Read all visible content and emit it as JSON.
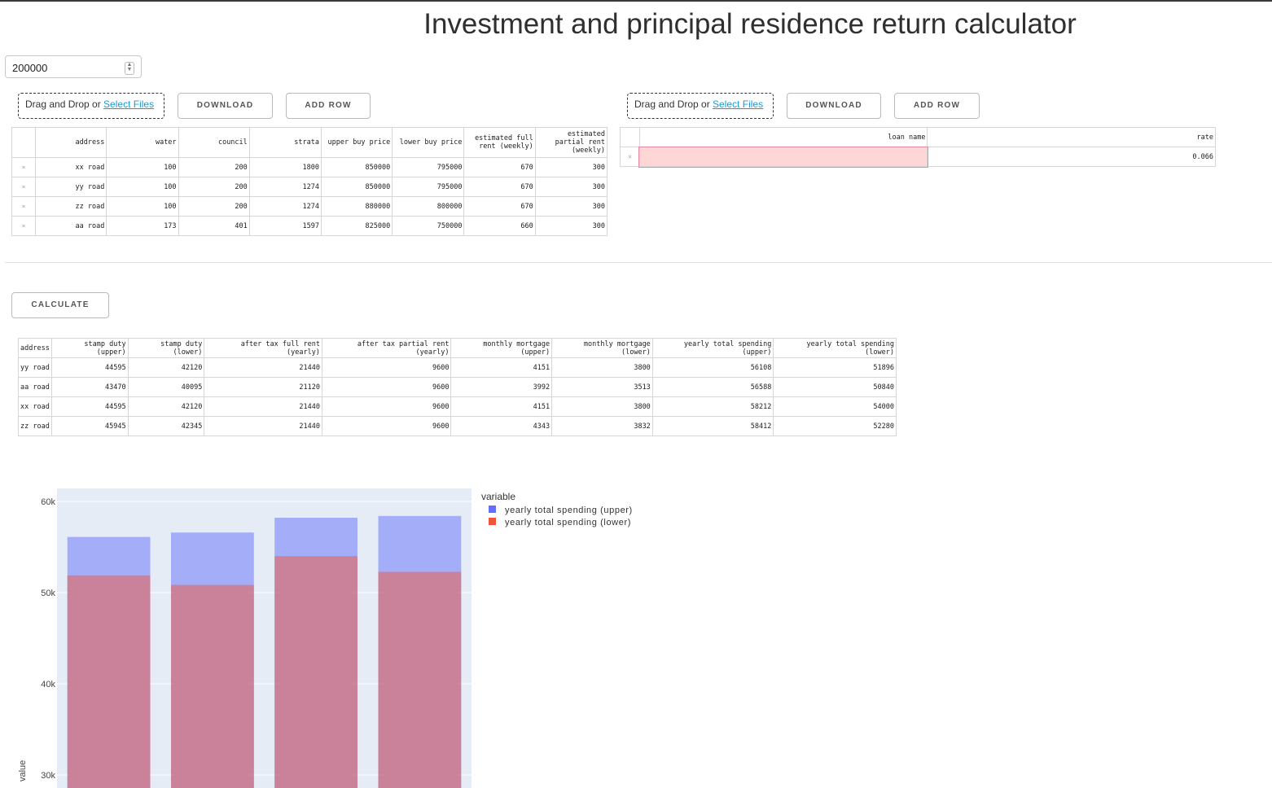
{
  "page": {
    "title": "Investment and principal residence return calculator"
  },
  "amount_input": {
    "value": "200000"
  },
  "upload_left": {
    "prefix": "Drag and Drop or ",
    "link": "Select Files"
  },
  "upload_right": {
    "prefix": "Drag and Drop or ",
    "link": "Select Files"
  },
  "buttons": {
    "download_left": "DOWNLOAD",
    "add_row_left": "ADD ROW",
    "download_right": "DOWNLOAD",
    "add_row_right": "ADD ROW",
    "calculate": "CALCULATE"
  },
  "property_table": {
    "delete_glyph": "×",
    "columns": [
      "address",
      "water",
      "council",
      "strata",
      "upper buy price",
      "lower buy price",
      "estimated full rent (weekly)",
      "estimated partial rent (weekly)"
    ],
    "rows": [
      [
        "xx road",
        "100",
        "200",
        "1800",
        "850000",
        "795000",
        "670",
        "300"
      ],
      [
        "yy road",
        "100",
        "200",
        "1274",
        "850000",
        "795000",
        "670",
        "300"
      ],
      [
        "zz road",
        "100",
        "200",
        "1274",
        "880000",
        "800000",
        "670",
        "300"
      ],
      [
        "aa road",
        "173",
        "401",
        "1597",
        "825000",
        "750000",
        "660",
        "300"
      ]
    ]
  },
  "loan_table": {
    "delete_glyph": "×",
    "columns": [
      "loan name",
      "rate"
    ],
    "rows": [
      [
        "",
        "0.066"
      ]
    ]
  },
  "results_table": {
    "columns": [
      "address",
      "stamp duty (upper)",
      "stamp duty (lower)",
      "after tax full rent (yearly)",
      "after tax partial rent (yearly)",
      "monthly mortgage (upper)",
      "monthly mortgage (lower)",
      "yearly total spending (upper)",
      "yearly total spending (lower)"
    ],
    "rows": [
      [
        "yy road",
        "44595",
        "42120",
        "21440",
        "9600",
        "4151",
        "3800",
        "56108",
        "51896"
      ],
      [
        "aa road",
        "43470",
        "40095",
        "21120",
        "9600",
        "3992",
        "3513",
        "56588",
        "50840"
      ],
      [
        "xx road",
        "44595",
        "42120",
        "21440",
        "9600",
        "4151",
        "3800",
        "58212",
        "54000"
      ],
      [
        "zz road",
        "45945",
        "42345",
        "21440",
        "9600",
        "4343",
        "3832",
        "58412",
        "52280"
      ]
    ]
  },
  "chart_data": {
    "type": "bar",
    "barmode": "overlay",
    "categories": [
      "yy road",
      "aa road",
      "xx road",
      "zz road"
    ],
    "series": [
      {
        "name": "yearly total spending (upper)",
        "values": [
          56108,
          56588,
          58212,
          58412
        ],
        "color": "#636efa"
      },
      {
        "name": "yearly total spending (lower)",
        "values": [
          51896,
          50840,
          54000,
          52280
        ],
        "color": "#ef553b"
      }
    ],
    "legend_title": "variable",
    "ylabel": "value",
    "yticks": [
      "60k",
      "50k",
      "40k",
      "30k"
    ],
    "ytick_values": [
      60000,
      50000,
      40000,
      30000
    ],
    "plot_bg": "#e5ecf6"
  }
}
